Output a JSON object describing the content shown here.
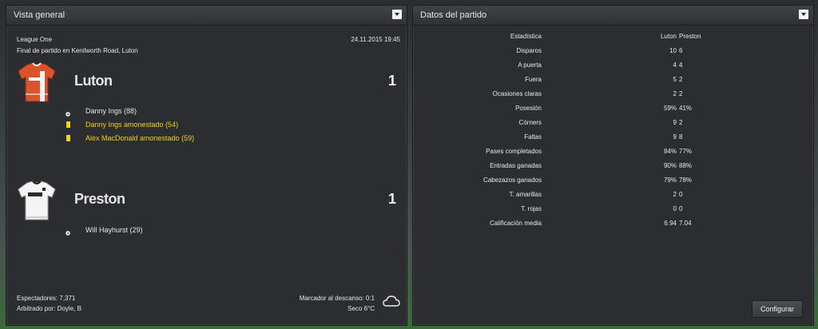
{
  "overview": {
    "title": "Vista general",
    "competition": "League One",
    "datetime": "24.11.2015 19:45",
    "venue": "Final de partido en Kenilworth Road, Luton",
    "home": {
      "name": "Luton",
      "score": "1",
      "events": [
        {
          "icon": "ball-icon",
          "text": "Danny Ings (88)",
          "highlight": false
        },
        {
          "icon": "yellow-card-icon",
          "text": "Danny Ings amonestado (54)",
          "highlight": true
        },
        {
          "icon": "yellow-card-icon",
          "text": "Alex MacDonald amonestado (59)",
          "highlight": true
        }
      ]
    },
    "away": {
      "name": "Preston",
      "score": "1",
      "events": [
        {
          "icon": "ball-icon",
          "text": "Will Hayhurst (29)",
          "highlight": false
        }
      ]
    },
    "attendance": "Espectadores: 7,371",
    "referee": "Arbitrado por: Doyle, B",
    "halftime": "Marcador al descanso: 0:1",
    "weather": "Seco 6°C",
    "weather_icon": "cloud-icon"
  },
  "match_stats": {
    "title": "Datos del partido",
    "header": {
      "label": "Estadística",
      "home": "Luton",
      "away": "Preston"
    },
    "rows": [
      {
        "label": "Disparos",
        "home": "10",
        "away": "6"
      },
      {
        "label": "A puerta",
        "home": "4",
        "away": "4"
      },
      {
        "label": "Fuera",
        "home": "5",
        "away": "2"
      },
      {
        "label": "Ocasiones claras",
        "home": "2",
        "away": "2"
      },
      {
        "label": "Posesión",
        "home": "59%",
        "away": "41%"
      },
      {
        "label": "Córners",
        "home": "9",
        "away": "2"
      },
      {
        "label": "Faltas",
        "home": "9",
        "away": "8"
      },
      {
        "label": "Pases completados",
        "home": "84%",
        "away": "77%"
      },
      {
        "label": "Entradas ganadas",
        "home": "90%",
        "away": "88%"
      },
      {
        "label": "Cabezazos ganados",
        "home": "79%",
        "away": "78%"
      },
      {
        "label": "T. amarillas",
        "home": "2",
        "away": "0"
      },
      {
        "label": "T. rojas",
        "home": "0",
        "away": "0"
      },
      {
        "label": "Calificación media",
        "home": "6.94",
        "away": "7.04"
      }
    ],
    "configure_label": "Configurar"
  },
  "colors": {
    "card_yellow": "#f2d21c",
    "luton_kit": "#d9532c",
    "preston_kit": "#f4f4f4"
  }
}
